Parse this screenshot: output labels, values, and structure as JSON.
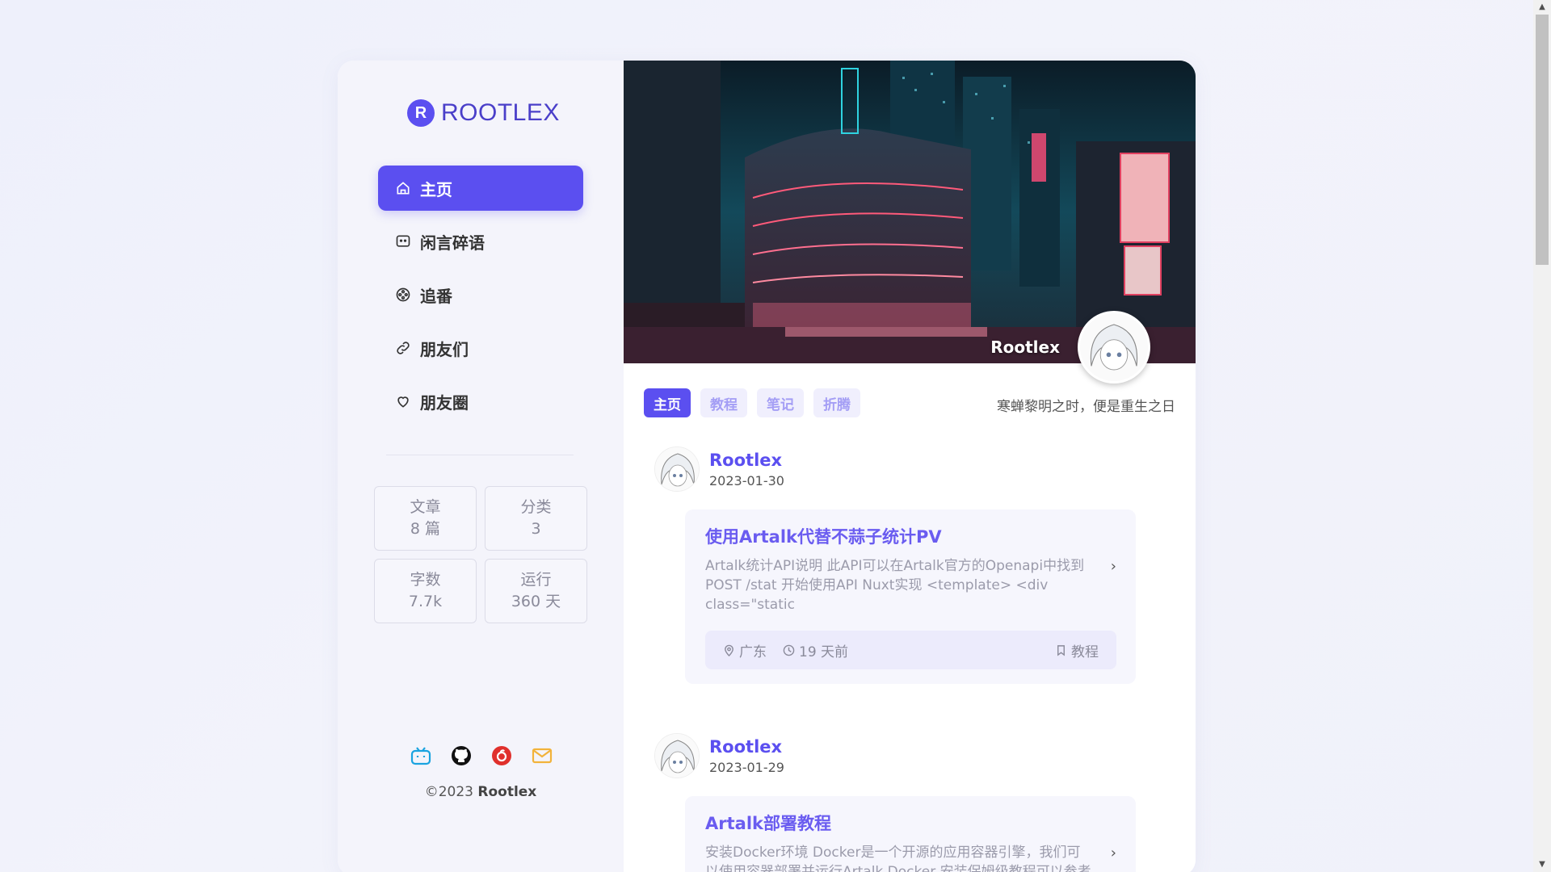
{
  "logo": {
    "mark": "R",
    "text": "ROOTLEX"
  },
  "nav": [
    {
      "label": "主页",
      "icon": "home-icon",
      "active": true
    },
    {
      "label": "闲言碎语",
      "icon": "chat-icon"
    },
    {
      "label": "追番",
      "icon": "film-reel-icon"
    },
    {
      "label": "朋友们",
      "icon": "link-icon"
    },
    {
      "label": "朋友圈",
      "icon": "heart-icon"
    }
  ],
  "stats": [
    {
      "label": "文章",
      "value": "8 篇"
    },
    {
      "label": "分类",
      "value": "3"
    },
    {
      "label": "字数",
      "value": "7.7k"
    },
    {
      "label": "运行",
      "value": "360 天"
    }
  ],
  "social": [
    "bilibili-icon",
    "github-icon",
    "netease-music-icon",
    "mail-icon"
  ],
  "copyright": {
    "year": "©2023",
    "name": "Rootlex"
  },
  "banner": {
    "name": "Rootlex"
  },
  "tabs": [
    "主页",
    "教程",
    "笔记",
    "折腾"
  ],
  "motto": "寒蝉黎明之时，便是重生之日",
  "posts": [
    {
      "author": "Rootlex",
      "date": "2023-01-30",
      "title": "使用Artalk代替不蒜子统计PV",
      "excerpt": "Artalk统计API说明 此API可以在Artalk官方的Openapi中找到 POST /stat 开始使用API Nuxt实现 <template> <div class=\"static",
      "location": "广东",
      "time": "19 天前",
      "category": "教程"
    },
    {
      "author": "Rootlex",
      "date": "2023-01-29",
      "title": "Artalk部署教程",
      "excerpt": "安装Docker环境 Docker是一个开源的应用容器引擎，我们可以使用容器部署并运行Artalk Docker 安装保姆级教程可以参考"
    }
  ],
  "colors": {
    "accent": "#5b4ff0",
    "sidebar_bg": "#f4f4fb"
  }
}
